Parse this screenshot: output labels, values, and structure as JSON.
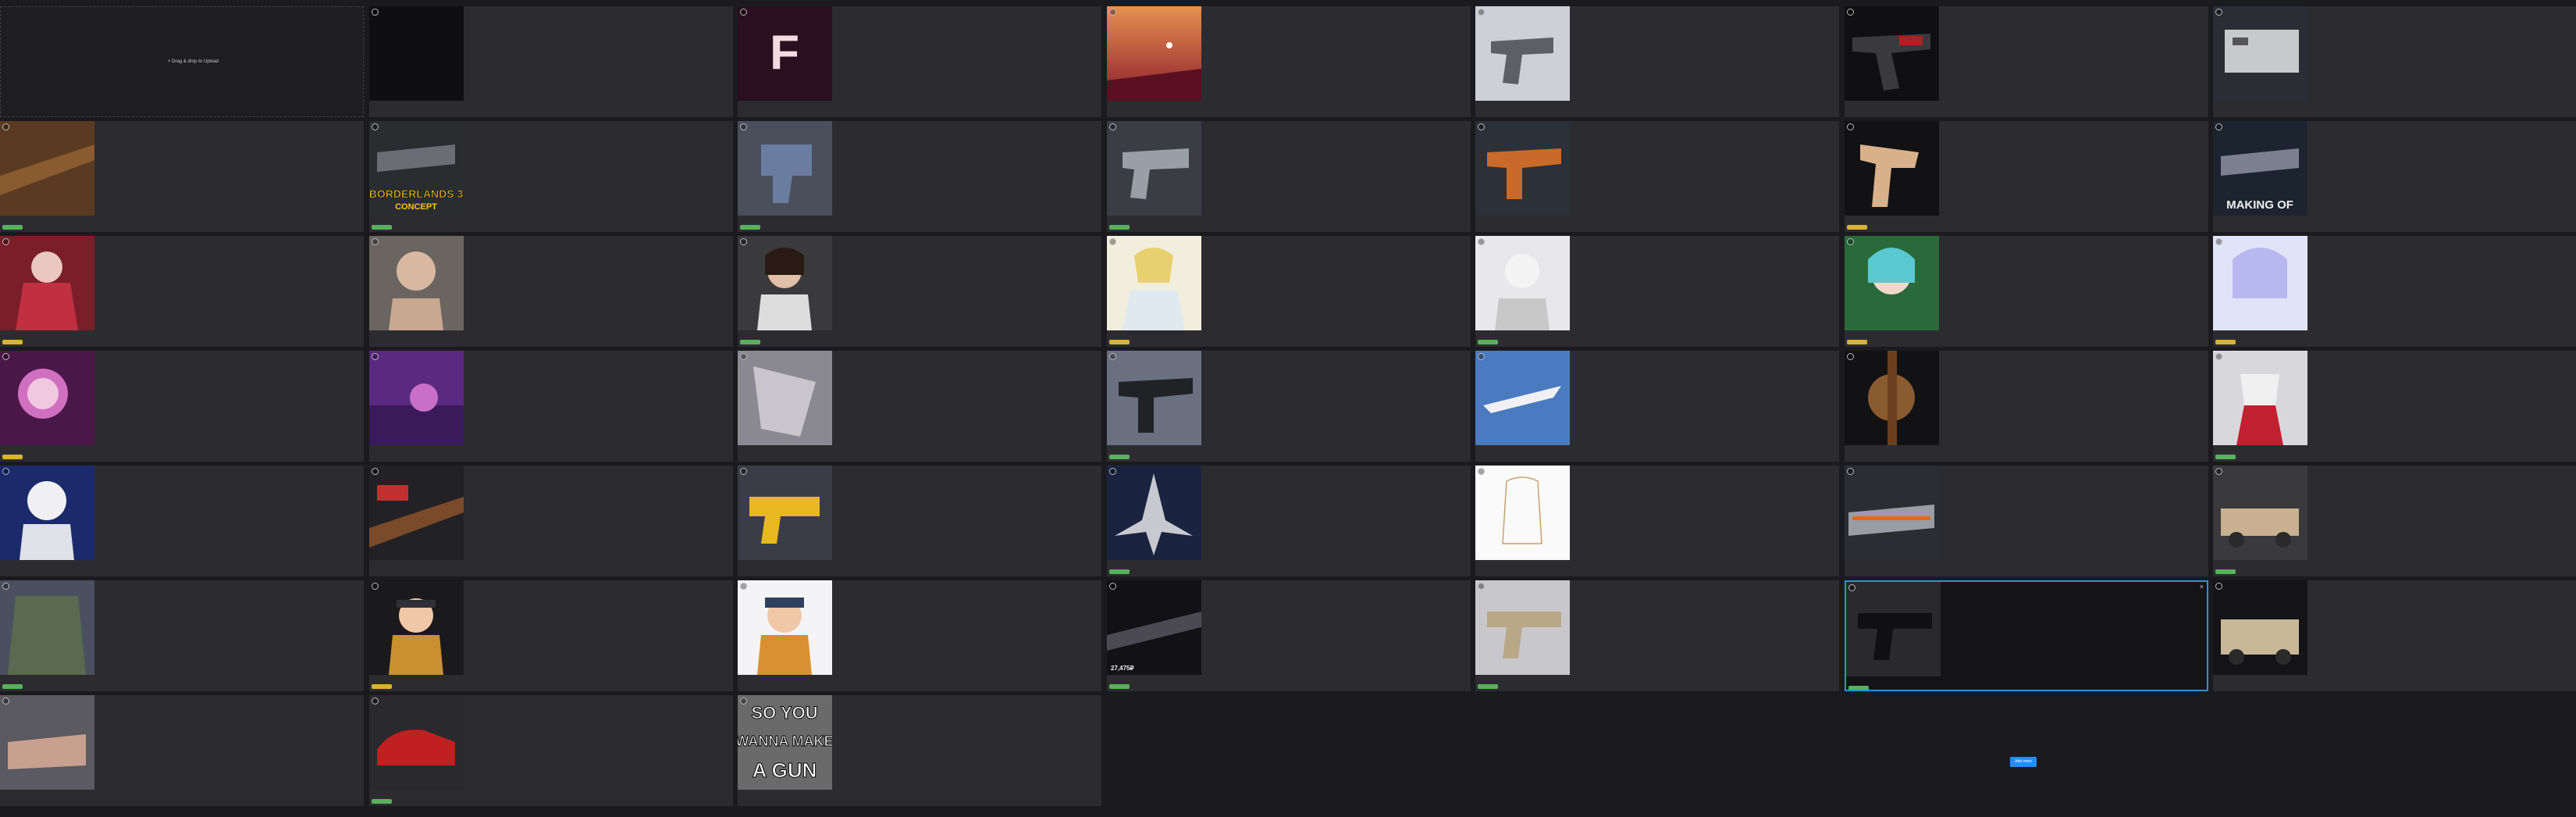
{
  "upload": {
    "label": "+ Drag & drop to Upload"
  },
  "action_button": {
    "label": "Add more"
  },
  "cards": [
    {
      "art": "text",
      "title": "",
      "badge": "",
      "stats": ""
    },
    {
      "art": "F",
      "title": "",
      "badge": "",
      "stats": ""
    },
    {
      "art": "sunset",
      "title": "",
      "badge": "",
      "stats": ""
    },
    {
      "art": "pistol-grey",
      "title": "",
      "badge": "",
      "stats": ""
    },
    {
      "art": "pistol-red",
      "title": "",
      "badge": "",
      "stats": ""
    },
    {
      "art": "mech",
      "title": "",
      "badge": "",
      "stats": ""
    },
    {
      "art": "rifle-brown",
      "title": "",
      "badge": "green",
      "stats": ""
    },
    {
      "art": "bl3",
      "title": "",
      "badge": "green",
      "stats": ""
    },
    {
      "art": "blaster-blue",
      "title": "",
      "badge": "green",
      "stats": ""
    },
    {
      "art": "blaster-grey",
      "title": "",
      "badge": "green",
      "stats": ""
    },
    {
      "art": "pistol-orange",
      "title": "",
      "badge": "",
      "stats": ""
    },
    {
      "art": "pistol-tan",
      "title": "",
      "badge": "yellow",
      "stats": ""
    },
    {
      "art": "makingof",
      "title": "",
      "badge": "",
      "stats": ""
    },
    {
      "art": "girl-red",
      "title": "",
      "badge": "yellow",
      "stats": ""
    },
    {
      "art": "bust",
      "title": "",
      "badge": "",
      "stats": ""
    },
    {
      "art": "girl-dark",
      "title": "",
      "badge": "green",
      "stats": ""
    },
    {
      "art": "anime-yellow",
      "title": "",
      "badge": "yellow",
      "stats": ""
    },
    {
      "art": "anime-white",
      "title": "",
      "badge": "green",
      "stats": ""
    },
    {
      "art": "anime-teal",
      "title": "",
      "badge": "yellow",
      "stats": ""
    },
    {
      "art": "anime-purple",
      "title": "",
      "badge": "yellow",
      "stats": ""
    },
    {
      "art": "purple-girl",
      "title": "",
      "badge": "yellow",
      "stats": ""
    },
    {
      "art": "purple-scene",
      "title": "",
      "badge": "",
      "stats": ""
    },
    {
      "art": "sketch",
      "title": "",
      "badge": "",
      "stats": ""
    },
    {
      "art": "pistol-black",
      "title": "",
      "badge": "green",
      "stats": ""
    },
    {
      "art": "jet-white",
      "title": "",
      "badge": "",
      "stats": ""
    },
    {
      "art": "cannon",
      "title": "",
      "badge": "",
      "stats": ""
    },
    {
      "art": "miko",
      "title": "",
      "badge": "green",
      "stats": ""
    },
    {
      "art": "astronaut",
      "title": "",
      "badge": "",
      "stats": ""
    },
    {
      "art": "shotgun",
      "title": "",
      "badge": "",
      "stats": ""
    },
    {
      "art": "blaster-yellow",
      "title": "",
      "badge": "",
      "stats": ""
    },
    {
      "art": "jet-space",
      "title": "",
      "badge": "green",
      "stats": ""
    },
    {
      "art": "lineart",
      "title": "",
      "badge": "",
      "stats": ""
    },
    {
      "art": "tank-grey",
      "title": "",
      "badge": "",
      "stats": ""
    },
    {
      "art": "tank-tan",
      "title": "",
      "badge": "green",
      "stats": ""
    },
    {
      "art": "armor",
      "title": "",
      "badge": "green",
      "stats": ""
    },
    {
      "art": "girl-cap",
      "title": "",
      "badge": "yellow",
      "stats": ""
    },
    {
      "art": "girl-cap2",
      "title": "",
      "badge": "",
      "stats": ""
    },
    {
      "art": "rifle-ad",
      "title": "",
      "badge": "green",
      "stats": ""
    },
    {
      "art": "smg-tan",
      "title": "",
      "badge": "green",
      "stats": ""
    },
    {
      "art": "smg-black",
      "title": "",
      "badge": "green",
      "stats": ""
    },
    {
      "art": "apc",
      "title": "",
      "badge": "",
      "stats": ""
    },
    {
      "art": "tank-pink",
      "title": "",
      "badge": "",
      "stats": ""
    },
    {
      "art": "car-red",
      "title": "",
      "badge": "green",
      "stats": ""
    },
    {
      "art": "soyou",
      "title": "",
      "badge": "",
      "stats": ""
    }
  ],
  "overlays": {
    "f_letter": "F",
    "bl3_line1": "BORDERLANDS 3",
    "bl3_line2": "CONCEPT",
    "makingof": "MAKING OF",
    "rifle_ad": "27,475₽",
    "soyou_1": "SO YOU",
    "soyou_2": "WANNA MAKE",
    "soyou_3": "A GUN"
  }
}
